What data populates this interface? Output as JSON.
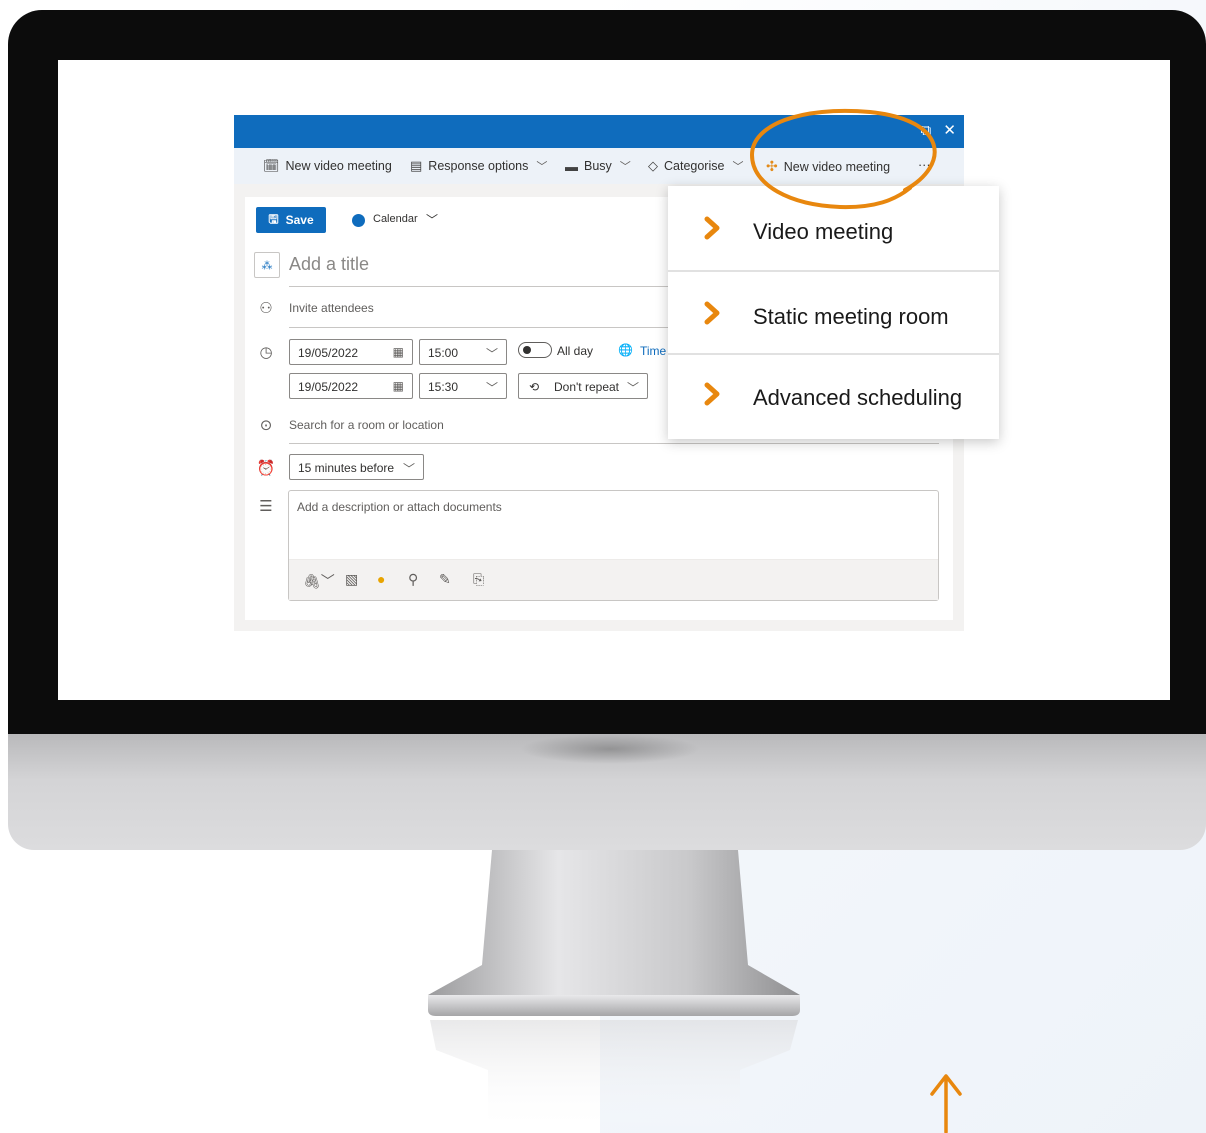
{
  "toolbar": {
    "new_video_meeting_label": "New video meeting",
    "response_options_label": "Response options",
    "busy_label": "Busy",
    "categorise_label": "Categorise",
    "new_video_meeting_addin_label": "New video meeting",
    "more_label": "···"
  },
  "form": {
    "save_label": "Save",
    "calendar_label": "Calendar",
    "title_placeholder": "Add a title",
    "invite_placeholder": "Invite attendees",
    "start_date": "19/05/2022",
    "start_time": "15:00",
    "end_date": "19/05/2022",
    "end_time": "15:30",
    "all_day_label": "All day",
    "time_zone_label": "Time",
    "repeat_label": "Don't repeat",
    "location_placeholder": "Search for a room or location",
    "reminder_label": "15 minutes before",
    "description_placeholder": "Add a description or attach documents"
  },
  "menu": {
    "items": [
      {
        "label": "Video meeting"
      },
      {
        "label": "Static meeting room"
      },
      {
        "label": "Advanced scheduling"
      }
    ]
  },
  "colors": {
    "accent_blue": "#0f6cbd",
    "highlight_orange": "#e8870e",
    "bezel": "#0c0c0c"
  }
}
